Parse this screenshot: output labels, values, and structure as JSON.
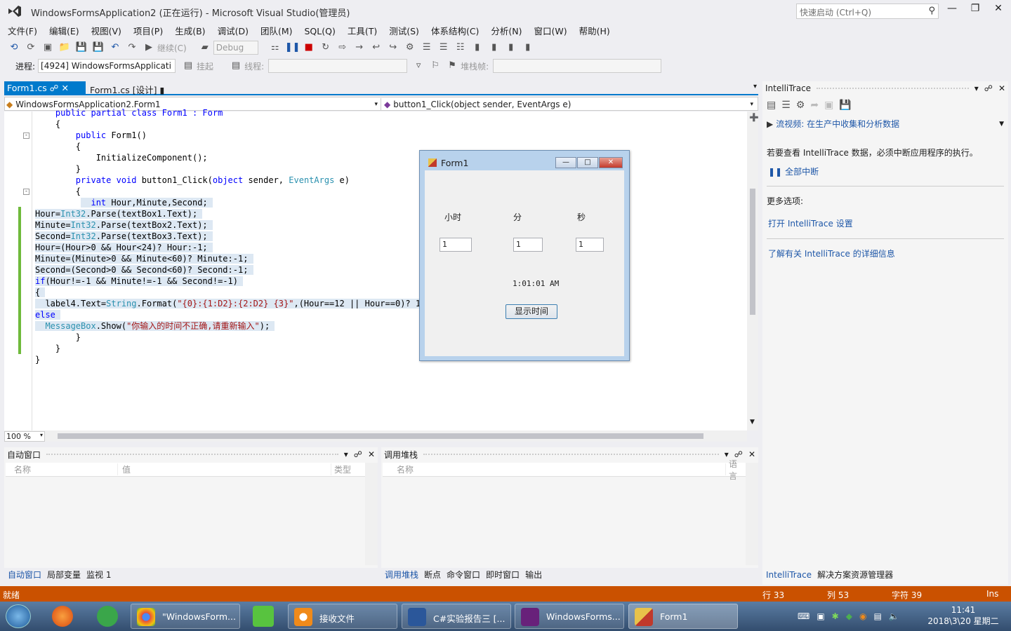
{
  "window": {
    "title": "WindowsFormsApplication2 (正在运行) - Microsoft Visual Studio(管理员)",
    "quick_launch_placeholder": "快速启动 (Ctrl+Q)"
  },
  "menu": [
    "文件(F)",
    "编辑(E)",
    "视图(V)",
    "项目(P)",
    "生成(B)",
    "调试(D)",
    "团队(M)",
    "SQL(Q)",
    "工具(T)",
    "测试(S)",
    "体系结构(C)",
    "分析(N)",
    "窗口(W)",
    "帮助(H)"
  ],
  "toolbar": {
    "continue_label": "继续(C)",
    "config": "Debug",
    "process_label": "进程:",
    "process_value": "[4924] WindowsFormsApplicati",
    "suspend_label": "挂起",
    "thread_label": "线程:",
    "stackframe_label": "堆栈帧:"
  },
  "tabs": [
    {
      "label": "Form1.cs",
      "active": true
    },
    {
      "label": "Form1.cs [设计]",
      "active": false
    }
  ],
  "navbar": {
    "class": "WindowsFormsApplication2.Form1",
    "member": "button1_Click(object sender, EventArgs e)"
  },
  "code": [
    "    public partial class Form1 : Form",
    "    {",
    "        public Form1()",
    "        {",
    "            InitializeComponent();",
    "        }",
    "",
    "        private void button1_Click(object sender, EventArgs e)",
    "        {",
    "           int Hour,Minute,Second;",
    "Hour=Int32.Parse(textBox1.Text);",
    "Minute=Int32.Parse(textBox2.Text);",
    "Second=Int32.Parse(textBox3.Text);",
    "Hour=(Hour>0 && Hour<24)? Hour:-1;",
    "Minute=(Minute>0 && Minute<60)? Minute:-1;",
    "Second=(Second>0 && Second<60)? Second:-1;",
    "if(Hour!=-1 && Minute!=-1 && Second!=-1)",
    "{",
    "  label4.Text=String.Format(\"{0}:{1:D2}:{2:D2} {3}\",(Hour==12 || Hour==0)? 12:",
    "else",
    "  MessageBox.Show(\"你输入的时间不正确,请重新输入\");",
    "",
    "        }",
    "    }",
    "}"
  ],
  "zoom": "100 %",
  "form1": {
    "title": "Form1",
    "label_hour": "小时",
    "label_minute": "分",
    "label_second": "秒",
    "textbox1": "1",
    "textbox2": "1",
    "textbox3": "1",
    "result": "1:01:01 AM",
    "button": "显示时间"
  },
  "autos": {
    "title": "自动窗口",
    "col_name": "名称",
    "col_value": "值",
    "col_type": "类型",
    "tabs": [
      "自动窗口",
      "局部变量",
      "监视 1"
    ]
  },
  "callstack": {
    "title": "调用堆栈",
    "col_name": "名称",
    "col_lang": "语言",
    "tabs": [
      "调用堆栈",
      "断点",
      "命令窗口",
      "即时窗口",
      "输出"
    ]
  },
  "intellitrace": {
    "title": "IntelliTrace",
    "video_link": "流视频: 在生产中收集和分析数据",
    "message": "若要查看 IntelliTrace 数据，必须中断应用程序的执行。",
    "break_all": "全部中断",
    "more_options": "更多选项:",
    "open_settings": "打开 IntelliTrace 设置",
    "learn_more": "了解有关 IntelliTrace 的详细信息",
    "tabs": [
      "IntelliTrace",
      "解决方案资源管理器"
    ]
  },
  "status": {
    "ready": "就绪",
    "line": "行 33",
    "col": "列 53",
    "char": "字符 39",
    "ins": "Ins"
  },
  "taskbar": {
    "tasks": [
      "\"WindowsForm...",
      "接收文件",
      "C#实验报告三 [...",
      "WindowsForms...",
      "Form1"
    ],
    "time": "11:41",
    "date": "2018\\3\\20 星期二"
  },
  "colors": {
    "accent": "#007acc",
    "status": "#ca5100"
  }
}
